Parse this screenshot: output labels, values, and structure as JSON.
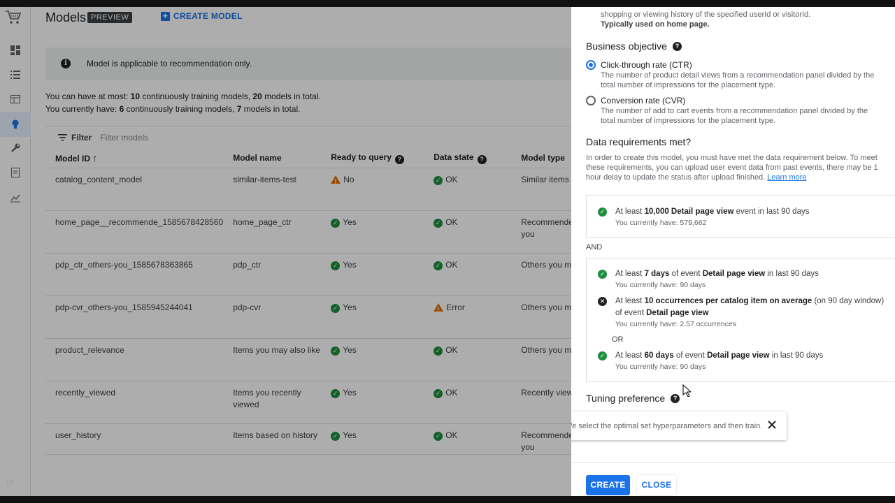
{
  "header": {
    "title": "Models",
    "badge": "PREVIEW",
    "create_label": "CREATE MODEL"
  },
  "info": {
    "message": "Model is applicable to recommendation only."
  },
  "limits": {
    "line1_pre": "You can have at most: ",
    "line1_n1": "10",
    "line1_mid": " continuously training models, ",
    "line1_n2": "20",
    "line1_post": " models in total.",
    "line2_pre": "You currently have: ",
    "line2_n1": "6",
    "line2_mid": " continuously training models, ",
    "line2_n2": "7",
    "line2_post": " models in total."
  },
  "filter": {
    "label": "Filter",
    "placeholder": "Filter models"
  },
  "table": {
    "columns": [
      "Model ID",
      "Model name",
      "Ready to query",
      "Data state",
      "Model type"
    ],
    "rows": [
      {
        "id": "catalog_content_model",
        "name": "similar-items-test",
        "ready": "No",
        "ready_status": "warn",
        "state": "OK",
        "state_status": "ok",
        "type": "Similar items"
      },
      {
        "id": "home_page__recommende_1585678428560",
        "name": "home_page_ctr",
        "ready": "Yes",
        "ready_status": "ok",
        "state": "OK",
        "state_status": "ok",
        "type": "Recommended for you"
      },
      {
        "id": "pdp_ctr_others-you_1585678363865",
        "name": "pdp_ctr",
        "ready": "Yes",
        "ready_status": "ok",
        "state": "OK",
        "state_status": "ok",
        "type": "Others you may like"
      },
      {
        "id": "pdp-cvr_others-you_1585945244041",
        "name": "pdp-cvr",
        "ready": "Yes",
        "ready_status": "ok",
        "state": "Error",
        "state_status": "warn",
        "type": "Others you may like"
      },
      {
        "id": "product_relevance",
        "name": "Items you may also like",
        "ready": "Yes",
        "ready_status": "ok",
        "state": "OK",
        "state_status": "ok",
        "type": "Others you may like"
      },
      {
        "id": "recently_viewed",
        "name": "Items you recently viewed",
        "ready": "Yes",
        "ready_status": "ok",
        "state": "OK",
        "state_status": "ok",
        "type": "Recently viewed"
      },
      {
        "id": "user_history",
        "name": "Items based on history",
        "ready": "Yes",
        "ready_status": "ok",
        "state": "OK",
        "state_status": "ok",
        "type": "Recommended for you"
      }
    ]
  },
  "panel": {
    "top_line1": "shopping or viewing history of the specified userId or visitorId.",
    "top_line2": "Typically used on home page.",
    "business_objective": {
      "heading": "Business objective",
      "options": [
        {
          "label": "Click-through rate (CTR)",
          "desc": "The number of product detail views from a recommendation panel divided by the total number of impressions for the placement type.",
          "selected": true
        },
        {
          "label": "Conversion rate (CVR)",
          "desc": "The number of add to cart events from a recommendation panel divided by the total number of impressions for the placement type.",
          "selected": false
        }
      ]
    },
    "data_req": {
      "heading": "Data requirements met?",
      "desc": "In order to create this model, you must have met the data requirement below. To meet these requirements, you can upload user event data from past events, there may be 1 hour delay to update the status after upload finished. ",
      "learn_more": "Learn more",
      "req1_a": "At least ",
      "req1_b": "10,000 Detail page view",
      "req1_c": " event in last 90 days",
      "req1_have": "You currently have: 579,662",
      "and_label": "AND",
      "req2_a": "At least ",
      "req2_b": "7 days",
      "req2_c": " of event ",
      "req2_d": "Detail page view",
      "req2_e": " in last 90 days",
      "req2_have": "You currently have: 90 days",
      "req3_a": "At least ",
      "req3_b": "10 occurrences per catalog item on average",
      "req3_c": " (on 90 day window) of event ",
      "req3_d": "Detail page view",
      "req3_have": "You currently have: 2.57 occurrences",
      "or_label": "OR",
      "req4_a": "At least ",
      "req4_b": "60 days",
      "req4_c": " of event ",
      "req4_d": "Detail page view",
      "req4_e": " in last 90 days",
      "req4_have": "You currently have: 90 days"
    },
    "tuning": {
      "heading": "Tuning preference"
    },
    "toast": {
      "text": "We select the optimal set hyperparameters and then train."
    },
    "buttons": {
      "create": "CREATE",
      "close": "CLOSE"
    }
  },
  "colors": {
    "accent": "#1a73e8",
    "ok": "#1e8e3e",
    "warn": "#e37400"
  }
}
